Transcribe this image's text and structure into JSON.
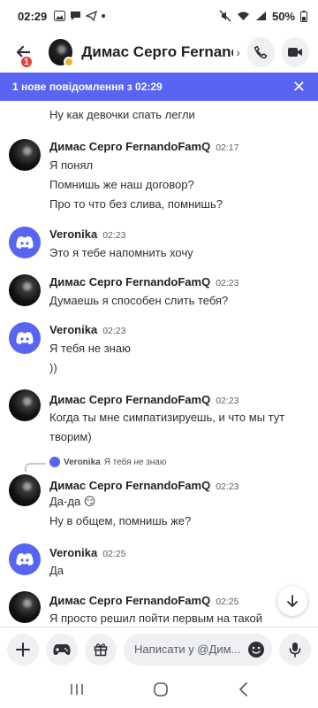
{
  "status_bar": {
    "time": "02:29",
    "battery": "50%"
  },
  "header": {
    "back_badge": "1",
    "title": "Димас Серго Fernand...",
    "chevron": "›"
  },
  "banner": {
    "text": "1 нове повідомлення з 02:29",
    "close": "✕"
  },
  "messages": [
    {
      "lines": [
        "Ну как девочки спать легли"
      ]
    },
    {
      "author": "Димас Серго FernandoFamQ",
      "time": "02:17",
      "lines": [
        "Я понял",
        "Помнишь же наш договор?",
        "Про то что без слива, помнишь?"
      ]
    },
    {
      "author": "Veronika",
      "time": "02:23",
      "lines": [
        "Это я тебе напомнить хочу"
      ]
    },
    {
      "author": "Димас Серго FernandoFamQ",
      "time": "02:23",
      "lines": [
        "Думаешь я способен слить тебя?"
      ]
    },
    {
      "author": "Veronika",
      "time": "02:23",
      "lines": [
        "Я тебя не знаю",
        "))"
      ]
    },
    {
      "author": "Димас Серго FernandoFamQ",
      "time": "02:23",
      "lines": [
        "Когда ты мне симпатизируешь, и что мы тут",
        "творим)"
      ]
    },
    {
      "reply_to": {
        "author": "Veronika",
        "text": "Я тебя не знаю"
      },
      "author": "Димас Серго FernandoFamQ",
      "time": "02:23",
      "lines": [
        "Да-да 😏",
        "Ну в общем, помнишь же?"
      ]
    },
    {
      "author": "Veronika",
      "time": "02:25",
      "lines": [
        "Да"
      ]
    },
    {
      "author": "Димас Серго FernandoFamQ",
      "time": "02:25",
      "lines": [
        "Я просто решил пойти первым на такой"
      ]
    }
  ],
  "composer": {
    "placeholder": "Написати у @Дим..."
  },
  "icons": {
    "back": "arrow-left-icon",
    "call": "phone-icon",
    "video": "video-camera-icon",
    "add": "plus-icon",
    "games": "gamepad-icon",
    "gift": "gift-icon",
    "emoji": "smile-icon",
    "mic": "microphone-icon",
    "scroll_down": "arrow-down-icon"
  },
  "colors": {
    "brand": "#5865f2",
    "badge": "#e53e3e",
    "status_idle": "#f0b232"
  }
}
